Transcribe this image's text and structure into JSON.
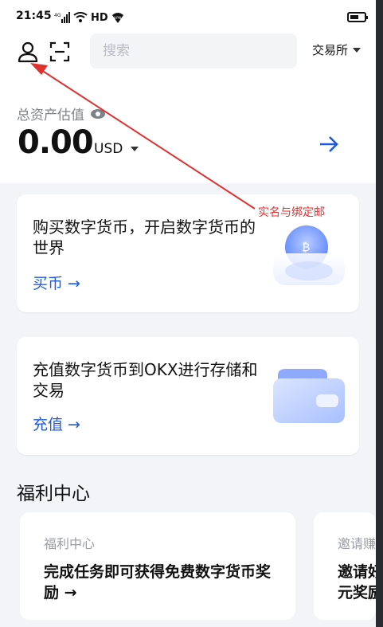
{
  "status": {
    "time": "21:45",
    "network": "4G",
    "hd": "HD",
    "vpn": "VPN"
  },
  "header": {
    "search_placeholder": "搜索",
    "exchange_label": "交易所"
  },
  "assets": {
    "label": "总资产估值",
    "amount": "0.00",
    "currency": "USD"
  },
  "cards": [
    {
      "title": "购买数字货币，开启数字货币的世界",
      "link": "买币 →"
    },
    {
      "title": "充值数字货币到OKX进行存储和交易",
      "link": "充值 →"
    }
  ],
  "welfare": {
    "heading": "福利中心",
    "cards": [
      {
        "label": "福利中心",
        "title": "完成任务即可获得免费数字货币奖励 →"
      },
      {
        "label": "邀请赚",
        "title": "邀请好友\n元奖励"
      }
    ]
  },
  "annotation": {
    "text": "实名与绑定邮",
    "color": "#e03030"
  },
  "colors": {
    "accent": "#1e5adb",
    "background": "#f3f4f8"
  }
}
